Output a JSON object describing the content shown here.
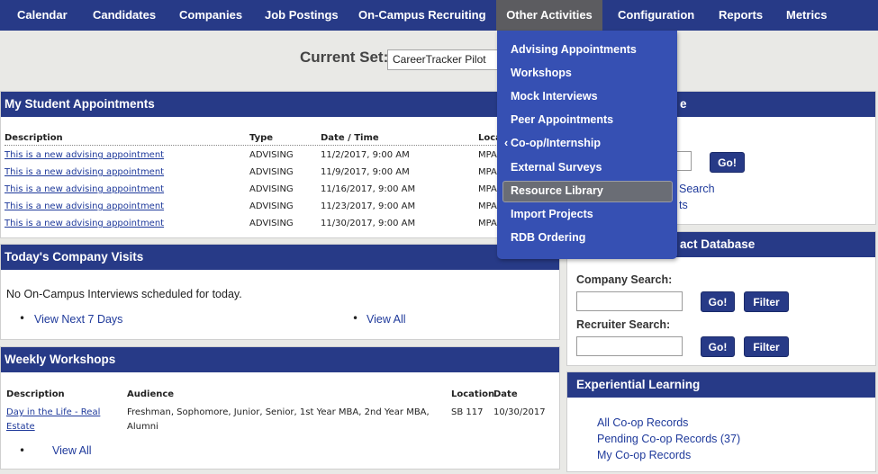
{
  "nav": {
    "items": [
      "Calendar",
      "Candidates",
      "Companies",
      "Job Postings",
      "On-Campus Recruiting",
      "Other Activities",
      "Configuration",
      "Reports",
      "Metrics"
    ]
  },
  "current_set": {
    "label": "Current Set:",
    "value": "CareerTracker Pilot"
  },
  "appointments": {
    "title": "My Student Appointments",
    "headers": [
      "Description",
      "Type",
      "Date / Time",
      "Loca"
    ],
    "rows": [
      {
        "desc": "This is a new advising appointment",
        "type": "ADVISING",
        "date": "11/2/2017, 9:00 AM",
        "loc": "MPA"
      },
      {
        "desc": "This is a new advising appointment",
        "type": "ADVISING",
        "date": "11/9/2017, 9:00 AM",
        "loc": "MPA"
      },
      {
        "desc": "This is a new advising appointment",
        "type": "ADVISING",
        "date": "11/16/2017, 9:00 AM",
        "loc": "MPA"
      },
      {
        "desc": "This is a new advising appointment",
        "type": "ADVISING",
        "date": "11/23/2017, 9:00 AM",
        "loc": "MPA"
      },
      {
        "desc": "This is a new advising appointment",
        "type": "ADVISING",
        "date": "11/30/2017, 9:00 AM",
        "loc": "MPA"
      }
    ]
  },
  "visits": {
    "title": "Today's Company Visits",
    "message": "No On-Campus Interviews scheduled for today.",
    "links": [
      "View Next 7 Days",
      "View All"
    ]
  },
  "workshops": {
    "title": "Weekly Workshops",
    "headers": [
      "Description",
      "Audience",
      "Location",
      "Date"
    ],
    "row": {
      "desc_line1": "Day in the Life - Real",
      "desc_line2": "Estate",
      "aud_line1": "Freshman, Sophomore, Junior, Senior, 1st Year MBA, 2nd Year MBA,",
      "aud_line2": "Alumni",
      "location": "SB 117",
      "date": "10/30/2017"
    },
    "view_all": "View All"
  },
  "right_top": {
    "title_tail": "e",
    "go": "Go!",
    "link1": "Search",
    "link2": "ts"
  },
  "contact_db": {
    "title_tail": "act Database",
    "company_label": "Company Search:",
    "recruiter_label": "Recruiter Search:",
    "go": "Go!",
    "filter": "Filter"
  },
  "experiential": {
    "title": "Experiential Learning",
    "links": [
      "All Co-op Records",
      "Pending Co-op Records (37)",
      "My Co-op Records"
    ]
  },
  "dropdown": {
    "items": [
      "Advising Appointments",
      "Workshops",
      "Mock Interviews",
      "Peer Appointments",
      "Co-op/Internship",
      "External Surveys",
      "Resource Library",
      "Import Projects",
      "RDB Ordering"
    ],
    "highlighted": "Resource Library",
    "submenu_arrow": "‹"
  },
  "colors": {
    "nav": "#273a87",
    "nav_active": "#5c5c60",
    "panel_head": "#273a87",
    "dropdown": "#3650b3",
    "link": "#1f3a9b",
    "background": "#e9e9e6"
  }
}
